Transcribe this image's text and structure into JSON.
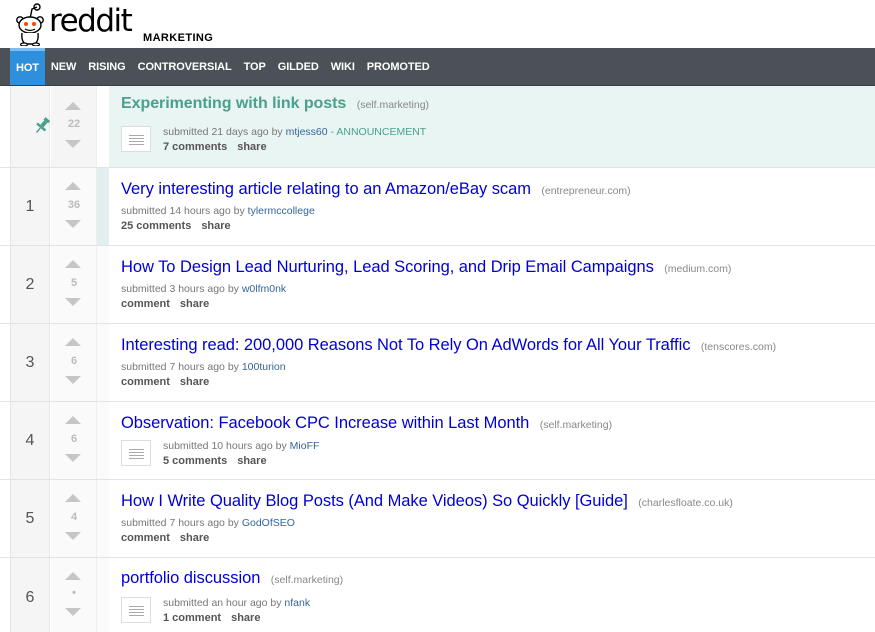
{
  "header": {
    "wordmark": "reddit",
    "subreddit": "MARKETING"
  },
  "tabs": [
    "HOT",
    "NEW",
    "RISING",
    "CONTROVERSIAL",
    "TOP",
    "GILDED",
    "WIKI",
    "PROMOTED"
  ],
  "active_tab": "HOT",
  "colors": {
    "link_blue": "#0000d4",
    "announcement_green": "#4aa08c",
    "tab_bar": "#4c5157",
    "active_tab": "#2e8fdc",
    "sticky_bg": "#e8f5f2"
  },
  "posts": [
    {
      "rank": "",
      "score": "22",
      "title": "Experimenting with link posts",
      "domain": "(self.marketing)",
      "submitted": "submitted 21 days ago by",
      "author": "mtjess60",
      "flair": "- ANNOUNCEMENT",
      "comments": "7 comments",
      "share": "share",
      "stickied": true,
      "has_thumb": true
    },
    {
      "rank": "1",
      "score": "36",
      "title": "Very interesting article relating to an Amazon/eBay scam",
      "domain": "(entrepreneur.com)",
      "submitted": "submitted 14 hours ago by",
      "author": "tylermccollege",
      "comments": "25 comments",
      "share": "share",
      "has_thumb": false
    },
    {
      "rank": "2",
      "score": "5",
      "title": "How To Design Lead Nurturing, Lead Scoring, and Drip Email Campaigns",
      "domain": "(medium.com)",
      "submitted": "submitted 3 hours ago by",
      "author": "w0lfm0nk",
      "comments": "comment",
      "share": "share",
      "has_thumb": false
    },
    {
      "rank": "3",
      "score": "6",
      "title": "Interesting read: 200,000 Reasons Not To Rely On AdWords for All Your Traffic",
      "domain": "(tenscores.com)",
      "submitted": "submitted 7 hours ago by",
      "author": "100turion",
      "comments": "comment",
      "share": "share",
      "has_thumb": false
    },
    {
      "rank": "4",
      "score": "6",
      "title": "Observation: Facebook CPC Increase within Last Month",
      "domain": "(self.marketing)",
      "submitted": "submitted 10 hours ago by",
      "author": "MioFF",
      "comments": "5 comments",
      "share": "share",
      "has_thumb": true
    },
    {
      "rank": "5",
      "score": "4",
      "title": "How I Write Quality Blog Posts (And Make Videos) So Quickly [Guide]",
      "domain": "(charlesfloate.co.uk)",
      "submitted": "submitted 7 hours ago by",
      "author": "GodOfSEO",
      "comments": "comment",
      "share": "share",
      "has_thumb": false
    },
    {
      "rank": "6",
      "score": "•",
      "title": "portfolio discussion",
      "domain": "(self.marketing)",
      "submitted": "submitted an hour ago by",
      "author": "nfank",
      "comments": "1 comment",
      "share": "share",
      "has_thumb": true
    }
  ]
}
